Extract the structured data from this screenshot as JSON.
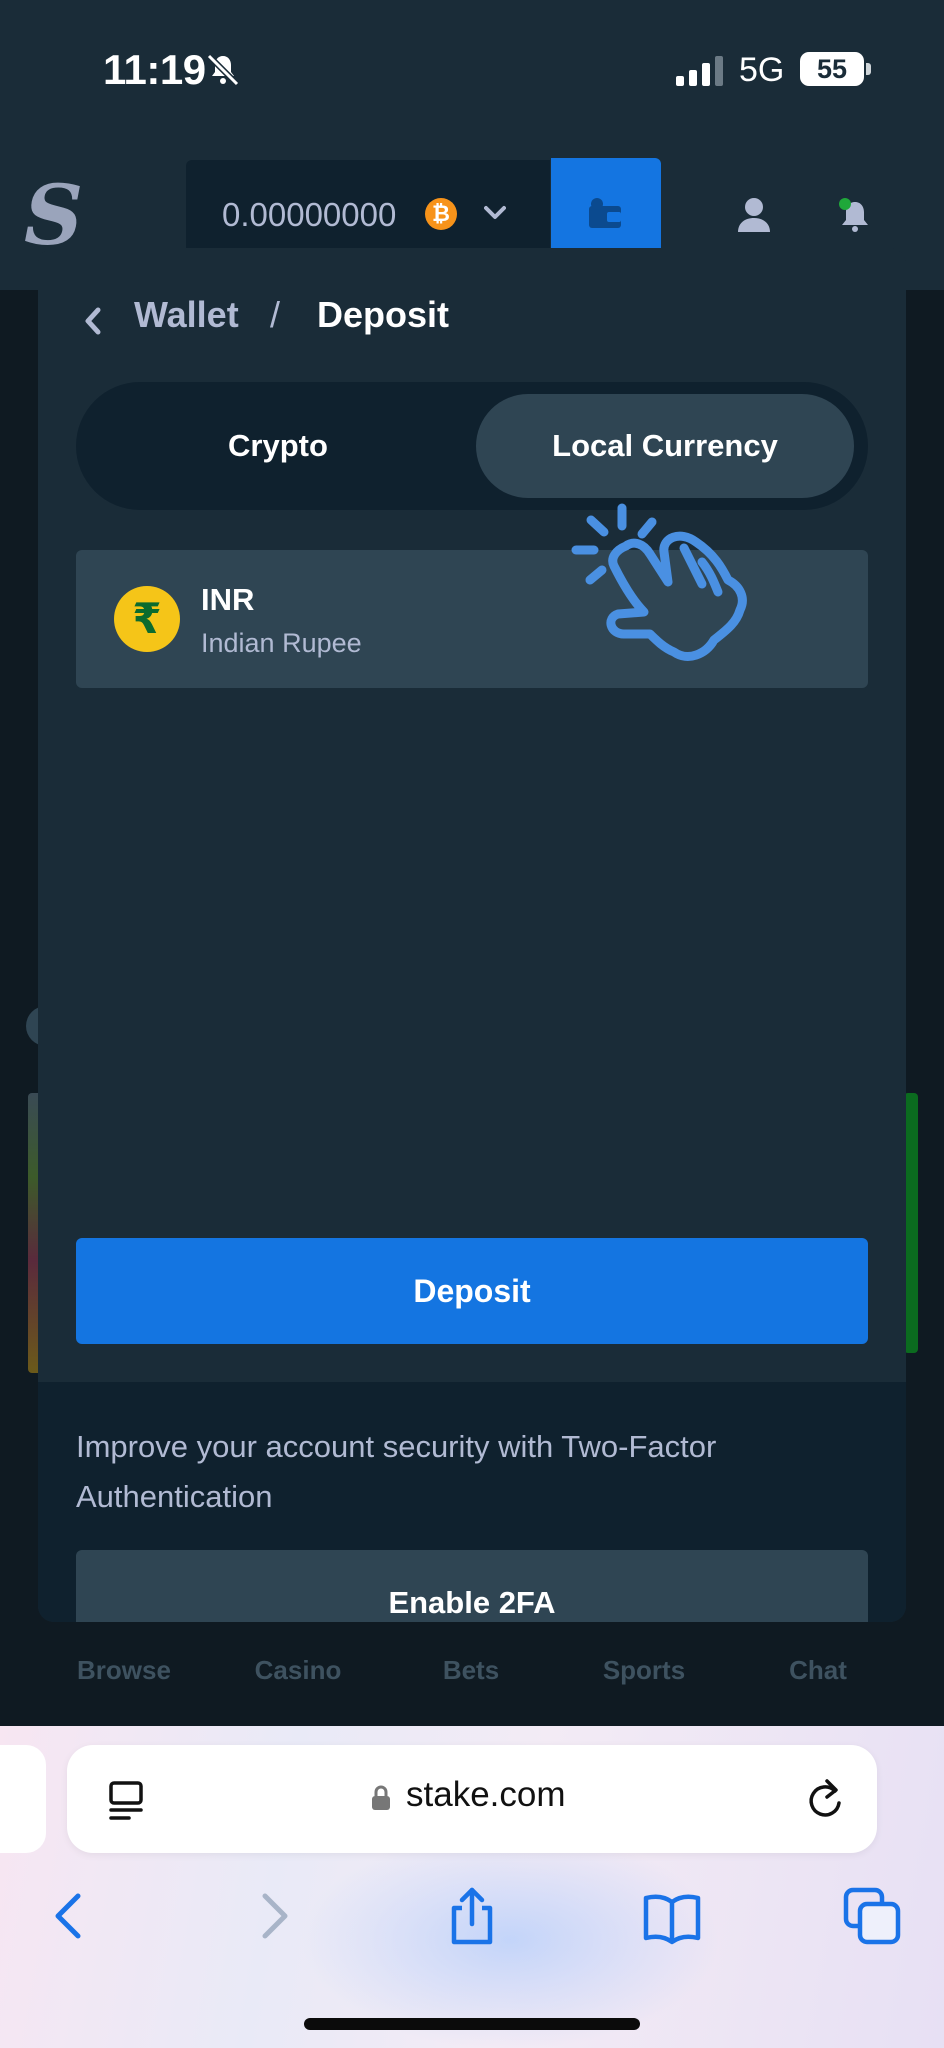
{
  "status_bar": {
    "time": "11:19",
    "network": "5G",
    "battery": "55"
  },
  "site_header": {
    "logo": "S",
    "balance": "0.00000000",
    "currency_icon": "bitcoin-icon"
  },
  "bottom_nav": {
    "items": [
      {
        "label": "Browse",
        "icon": "search-icon"
      },
      {
        "label": "Casino",
        "icon": "cards-icon"
      },
      {
        "label": "Bets",
        "icon": "ticket-icon"
      },
      {
        "label": "Sports",
        "icon": "ball-icon"
      },
      {
        "label": "Chat",
        "icon": "chat-icon"
      }
    ]
  },
  "modal": {
    "breadcrumb": {
      "parent": "Wallet",
      "separator": "/",
      "current": "Deposit"
    },
    "tabs": [
      {
        "label": "Crypto",
        "selected": false
      },
      {
        "label": "Local Currency",
        "selected": true
      }
    ],
    "currency": {
      "symbol": "₹",
      "code": "INR",
      "name": "Indian Rupee"
    },
    "deposit_label": "Deposit",
    "security": {
      "message": "Improve your account security with Two-Factor Authentication",
      "button_label": "Enable 2FA"
    }
  },
  "browser": {
    "url": "stake.com"
  },
  "colors": {
    "accent": "#1475e1",
    "panel": "#1a2c38",
    "card": "#2f4553",
    "dark": "#0f212e",
    "muted": "#b1bad3",
    "tap_hint": "#4a90e2"
  }
}
